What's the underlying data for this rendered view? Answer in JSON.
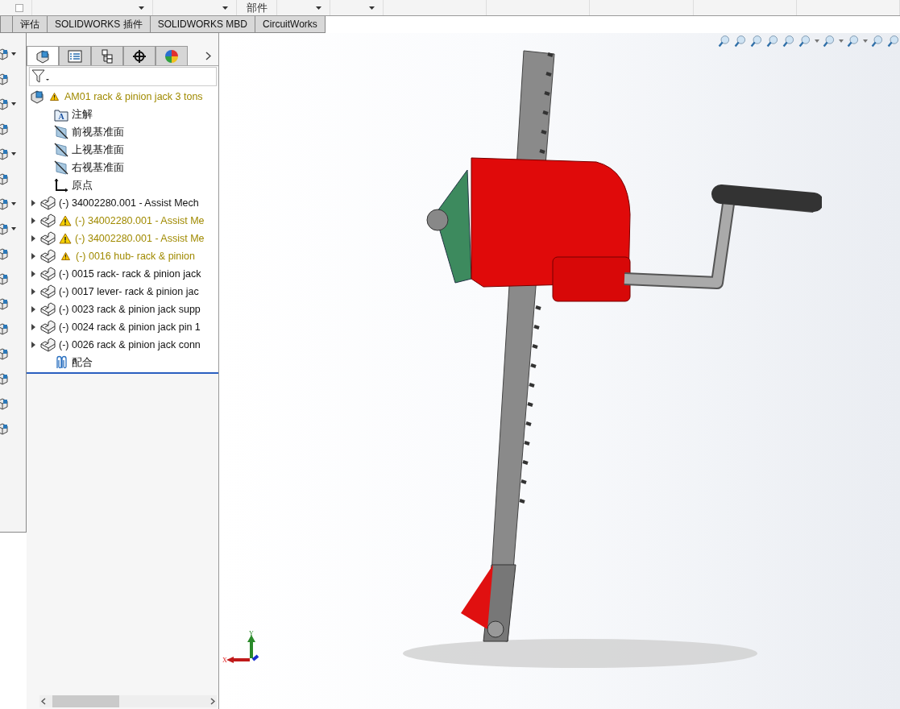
{
  "top_toolbar": {
    "label": "部件"
  },
  "command_tabs": [
    {
      "label": "评估",
      "selected": false
    },
    {
      "label": "SOLIDWORKS 插件",
      "selected": false
    },
    {
      "label": "SOLIDWORKS MBD",
      "selected": false
    },
    {
      "label": "CircuitWorks",
      "selected": false
    }
  ],
  "panel_tabs": [
    {
      "kind": "tree",
      "selected": true
    },
    {
      "kind": "properties",
      "selected": false
    },
    {
      "kind": "config",
      "selected": false
    },
    {
      "kind": "dimxpert",
      "selected": false
    },
    {
      "kind": "display",
      "selected": false
    }
  ],
  "feature_tree": {
    "root": {
      "label": "AM01 rack & pinion jack 3 tons",
      "warning": true,
      "warning_large": false
    },
    "items": [
      {
        "kind": "annotations",
        "label": "注解",
        "icon_letter": "A"
      },
      {
        "kind": "plane",
        "label": "前视基准面"
      },
      {
        "kind": "plane",
        "label": "上视基准面"
      },
      {
        "kind": "plane",
        "label": "右视基准面"
      },
      {
        "kind": "origin",
        "label": "原点"
      },
      {
        "kind": "component",
        "label": "(-) 34002280.001 - Assist Mech",
        "warning": false,
        "expanded": false
      },
      {
        "kind": "component",
        "label": "(-) 34002280.001 - Assist Me",
        "warning": true,
        "warning_large": true,
        "expanded": false
      },
      {
        "kind": "component",
        "label": "(-) 34002280.001 - Assist Me",
        "warning": true,
        "warning_large": true,
        "expanded": false
      },
      {
        "kind": "component",
        "label": "(-) 0016 hub- rack & pinion",
        "warning": true,
        "warning_large": false,
        "expanded": false
      },
      {
        "kind": "component",
        "label": "(-) 0015 rack- rack & pinion jack",
        "warning": false,
        "expanded": false
      },
      {
        "kind": "component",
        "label": "(-) 0017 lever- rack & pinion jac",
        "warning": false,
        "expanded": false
      },
      {
        "kind": "component",
        "label": "(-) 0023 rack & pinion jack supp",
        "warning": false,
        "expanded": false
      },
      {
        "kind": "component",
        "label": "(-) 0024 rack & pinion jack pin 1",
        "warning": false,
        "expanded": false
      },
      {
        "kind": "component",
        "label": "(-) 0026 rack & pinion jack conn",
        "warning": false,
        "expanded": false
      },
      {
        "kind": "mates",
        "label": "配合"
      }
    ]
  },
  "triad": {
    "x_label": "X",
    "y_label": "Y"
  }
}
